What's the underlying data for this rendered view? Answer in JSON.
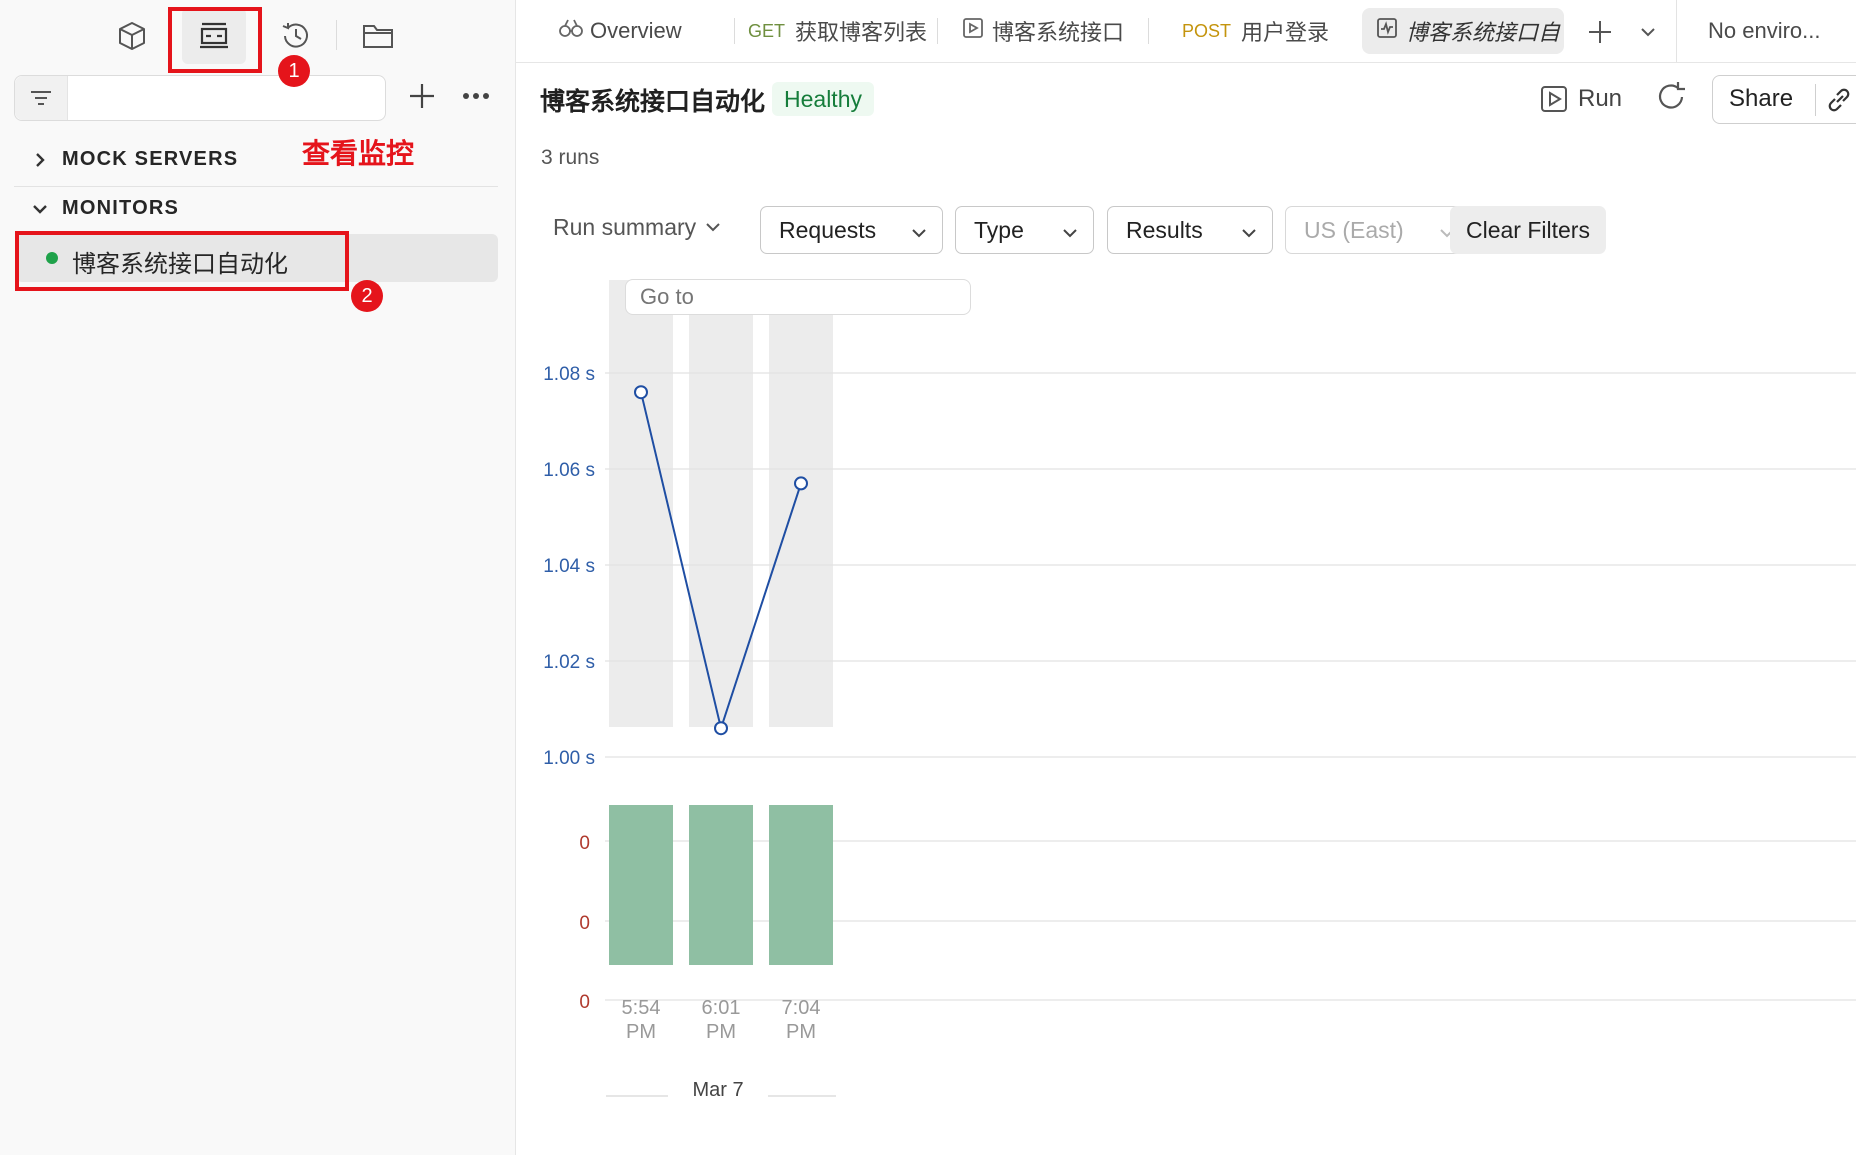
{
  "sidebar": {
    "top_icons": [
      "box-icon",
      "monitor-icon",
      "history-icon",
      "folder-icon"
    ],
    "sections": [
      {
        "label": "MOCK SERVERS",
        "expanded": false
      },
      {
        "label": "MONITORS",
        "expanded": true
      }
    ],
    "monitor_items": [
      {
        "label": "博客系统接口自动化",
        "status_color": "#1fa24a"
      }
    ]
  },
  "annotations": {
    "text": "查看监控",
    "badges": [
      "1",
      "2"
    ]
  },
  "tabs": {
    "items": [
      {
        "method": "",
        "label": "Overview",
        "icon": "overview-icon"
      },
      {
        "method": "GET",
        "label": "获取博客列表",
        "method_color": "#6f8f3f"
      },
      {
        "method": "",
        "label": "博客系统接口",
        "icon": "runner-icon"
      },
      {
        "method": "POST",
        "label": "用户登录",
        "method_color": "#c4940d"
      },
      {
        "method": "",
        "label": "博客系统接口自",
        "icon": "monitor-tab-icon",
        "active": true
      }
    ],
    "environment": "No enviro..."
  },
  "header": {
    "title": "博客系统接口自动化",
    "status": "Healthy",
    "runs": "3 runs",
    "run_label": "Run",
    "share_label": "Share"
  },
  "filters": {
    "run_summary": "Run summary",
    "requests": "Requests",
    "type": "Type",
    "results": "Results",
    "region": "US (East)",
    "clear": "Clear Filters",
    "goto_placeholder": "Go to"
  },
  "chart_data": {
    "type": "line",
    "ylabel_ticks": [
      "1.08 s",
      "1.06 s",
      "1.04 s",
      "1.02 s",
      "1.00 s"
    ],
    "ylim": [
      1.0,
      1.08
    ],
    "categories": [
      "5:54 PM",
      "6:01 PM",
      "7:04 PM"
    ],
    "cat_lines": [
      [
        "5:54",
        "PM"
      ],
      [
        "6:01",
        "PM"
      ],
      [
        "7:04",
        "PM"
      ]
    ],
    "date_label": "Mar 7",
    "series": [
      {
        "values": [
          1.076,
          1.006,
          1.057
        ],
        "color": "#1f4ea3"
      }
    ],
    "bars": {
      "ticks": [
        "0",
        "0",
        "0"
      ],
      "values": [
        1,
        1,
        1
      ],
      "color": "#8fbfa3"
    }
  }
}
